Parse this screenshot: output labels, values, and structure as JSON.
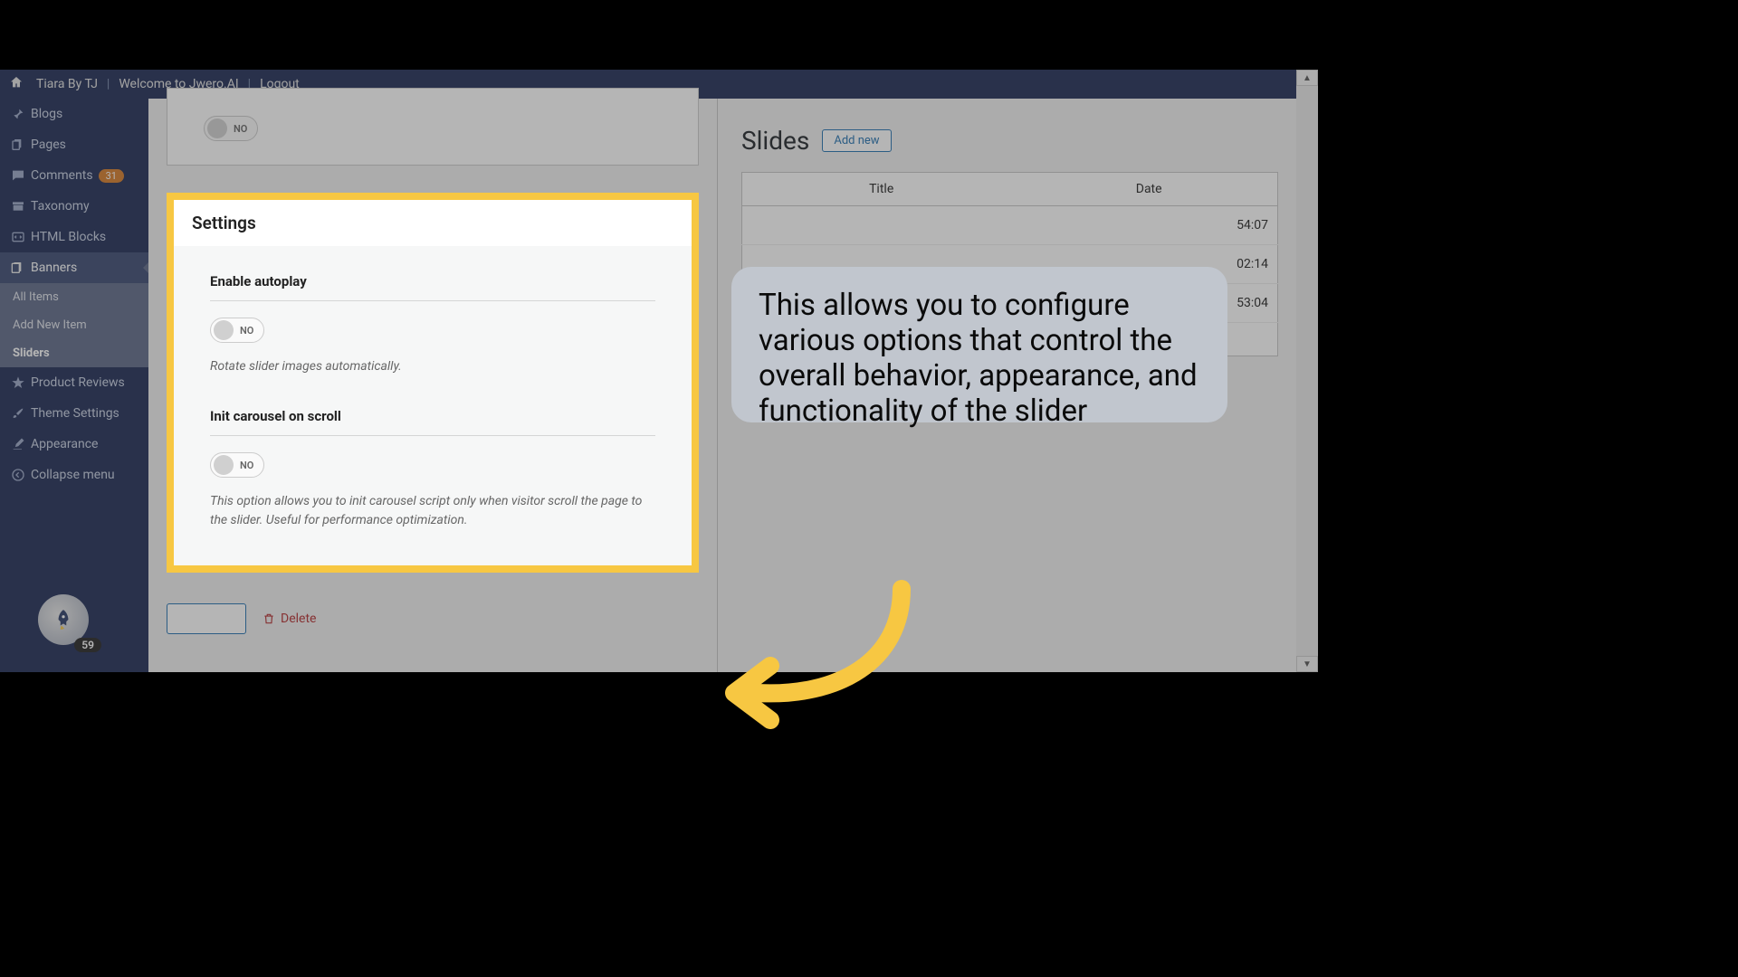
{
  "topbar": {
    "site": "Tiara By TJ",
    "welcome": "Welcome to Jwero.AI",
    "logout": "Logout"
  },
  "sidebar": {
    "items": [
      {
        "label": "Blogs",
        "icon": "pin"
      },
      {
        "label": "Pages",
        "icon": "pages"
      },
      {
        "label": "Comments",
        "icon": "comment",
        "badge": "31"
      },
      {
        "label": "Taxonomy",
        "icon": "archive"
      },
      {
        "label": "HTML Blocks",
        "icon": "code"
      },
      {
        "label": "Banners",
        "icon": "banners"
      },
      {
        "label": "Product Reviews",
        "icon": "star"
      },
      {
        "label": "Theme Settings",
        "icon": "brush"
      },
      {
        "label": "Appearance",
        "icon": "paint"
      },
      {
        "label": "Collapse menu",
        "icon": "collapse"
      }
    ],
    "submenu": {
      "items": [
        "All Items",
        "Add New Item",
        "Sliders"
      ],
      "selectedIndex": 2
    },
    "rocketCount": "59"
  },
  "panel1": {
    "toggleLabel": "NO"
  },
  "settings": {
    "title": "Settings",
    "autoplay": {
      "label": "Enable autoplay",
      "toggle": "NO",
      "desc": "Rotate slider images automatically."
    },
    "initCarousel": {
      "label": "Init carousel on scroll",
      "toggle": "NO",
      "desc": "This option allows you to init carousel script only when visitor scroll the page to the slider. Useful for performance optimization."
    }
  },
  "actions": {
    "delete": "Delete"
  },
  "slides": {
    "title": "Slides",
    "addNew": "Add new",
    "columns": {
      "title": "Title",
      "date": "Date"
    },
    "rows": [
      {
        "date_fragment": "54:07"
      },
      {
        "date_fragment": "02:14"
      },
      {
        "date_fragment": "53:04"
      }
    ]
  },
  "callout": {
    "text": "This allows you to configure various options that control the overall behavior, appearance, and functionality of the slider"
  }
}
